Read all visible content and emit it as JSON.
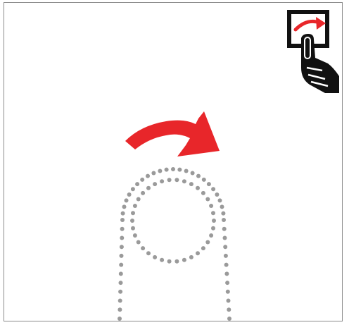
{
  "gesture": {
    "name": "rotate-clockwise-swipe",
    "icon_name": "rotate-gesture-icon",
    "main_arrow_icon": "curved-arrow-clockwise-icon",
    "finger_icon": "dotted-finger-outline-icon"
  },
  "colors": {
    "arrow": "#e8262a",
    "dots": "#9a9a9a",
    "icon_black": "#111111",
    "frame_border": "#8a8a8a",
    "background": "#ffffff"
  }
}
